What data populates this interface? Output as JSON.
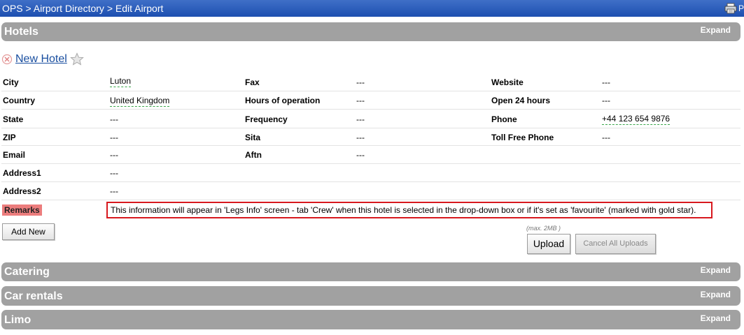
{
  "breadcrumb": {
    "items": [
      "OPS",
      "Airport Directory",
      "Edit Airport"
    ],
    "separator": ">"
  },
  "print": {
    "icon": "printer-icon",
    "label": "P"
  },
  "sections": {
    "hotels": {
      "title": "Hotels",
      "expand_label": "Expand"
    },
    "catering": {
      "title": "Catering",
      "expand_label": "Expand"
    },
    "car_rentals": {
      "title": "Car rentals",
      "expand_label": "Expand"
    },
    "limo": {
      "title": "Limo",
      "expand_label": "Expand"
    }
  },
  "hotel": {
    "name": "New Hotel",
    "remove_icon": "remove-icon",
    "favourite_icon": "star-icon",
    "fields": {
      "city": {
        "label": "City",
        "value": "Luton"
      },
      "country": {
        "label": "Country",
        "value": "United Kingdom"
      },
      "state": {
        "label": "State",
        "value": "---"
      },
      "zip": {
        "label": "ZIP",
        "value": "---"
      },
      "email": {
        "label": "Email",
        "value": "---"
      },
      "address1": {
        "label": "Address1",
        "value": "---"
      },
      "address2": {
        "label": "Address2",
        "value": "---"
      },
      "fax": {
        "label": "Fax",
        "value": "---"
      },
      "hours": {
        "label": "Hours of operation",
        "value": "---"
      },
      "frequency": {
        "label": "Frequency",
        "value": "---"
      },
      "sita": {
        "label": "Sita",
        "value": "---"
      },
      "aftn": {
        "label": "Aftn",
        "value": "---"
      },
      "website": {
        "label": "Website",
        "value": "---"
      },
      "open24": {
        "label": "Open 24 hours",
        "value": "---"
      },
      "phone": {
        "label": "Phone",
        "value": "+44 123 654 9876"
      },
      "tollfree": {
        "label": "Toll Free Phone",
        "value": "---"
      }
    },
    "remarks": {
      "label": "Remarks",
      "value": "This information will appear in 'Legs Info' screen - tab 'Crew' when this hotel is selected in the drop-down box or if it's set as 'favourite' (marked with gold star)."
    }
  },
  "buttons": {
    "add_new": "Add New",
    "upload_note": "(max. 2MB )",
    "upload": "Upload",
    "cancel_uploads": "Cancel All Uploads"
  },
  "colors": {
    "topbar": "#1d4fb0",
    "section_header": "#a1a1a1",
    "remarks_label_bg": "#ec7d7d",
    "remarks_border": "#d7181e",
    "editable_underline": "#3aa64a"
  }
}
